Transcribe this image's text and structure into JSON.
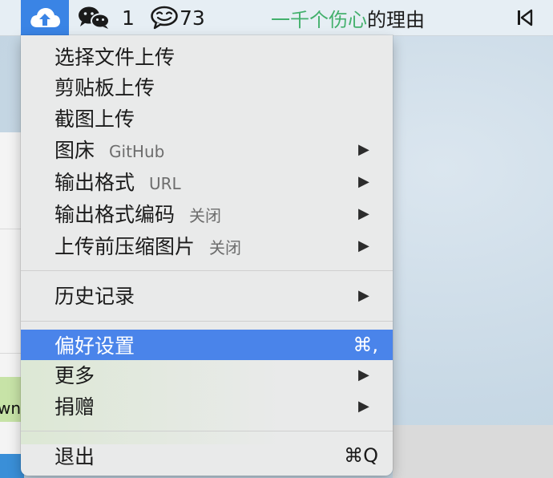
{
  "menubar": {
    "wechat_count": "1",
    "chat_count": "73",
    "title_green": "一千个伤心",
    "title_rest": "的理由"
  },
  "menu": {
    "items": [
      {
        "label": "选择文件上传"
      },
      {
        "label": "剪贴板上传"
      },
      {
        "label": "截图上传"
      },
      {
        "label": "图床",
        "sub": "GitHub"
      },
      {
        "label": "输出格式",
        "sub": "URL"
      },
      {
        "label": "输出格式编码",
        "sub": "关闭"
      },
      {
        "label": "上传前压缩图片",
        "sub": "关闭"
      },
      {
        "label": "历史记录"
      },
      {
        "label": "偏好设置",
        "shortcut": "⌘,",
        "selected": true
      },
      {
        "label": "更多"
      },
      {
        "label": "捐赠"
      },
      {
        "label": "退出",
        "shortcut": "⌘Q"
      }
    ]
  },
  "background": {
    "left_tab_text": "wn"
  },
  "colors": {
    "highlight": "#4a84ea",
    "title_green": "#43b06c",
    "app_icon_bg": "#3a84e5"
  },
  "icons": [
    "cloud-upload-icon",
    "wechat-icon",
    "chat-bubble-icon",
    "skip-back-icon",
    "submenu-arrow-icon"
  ]
}
